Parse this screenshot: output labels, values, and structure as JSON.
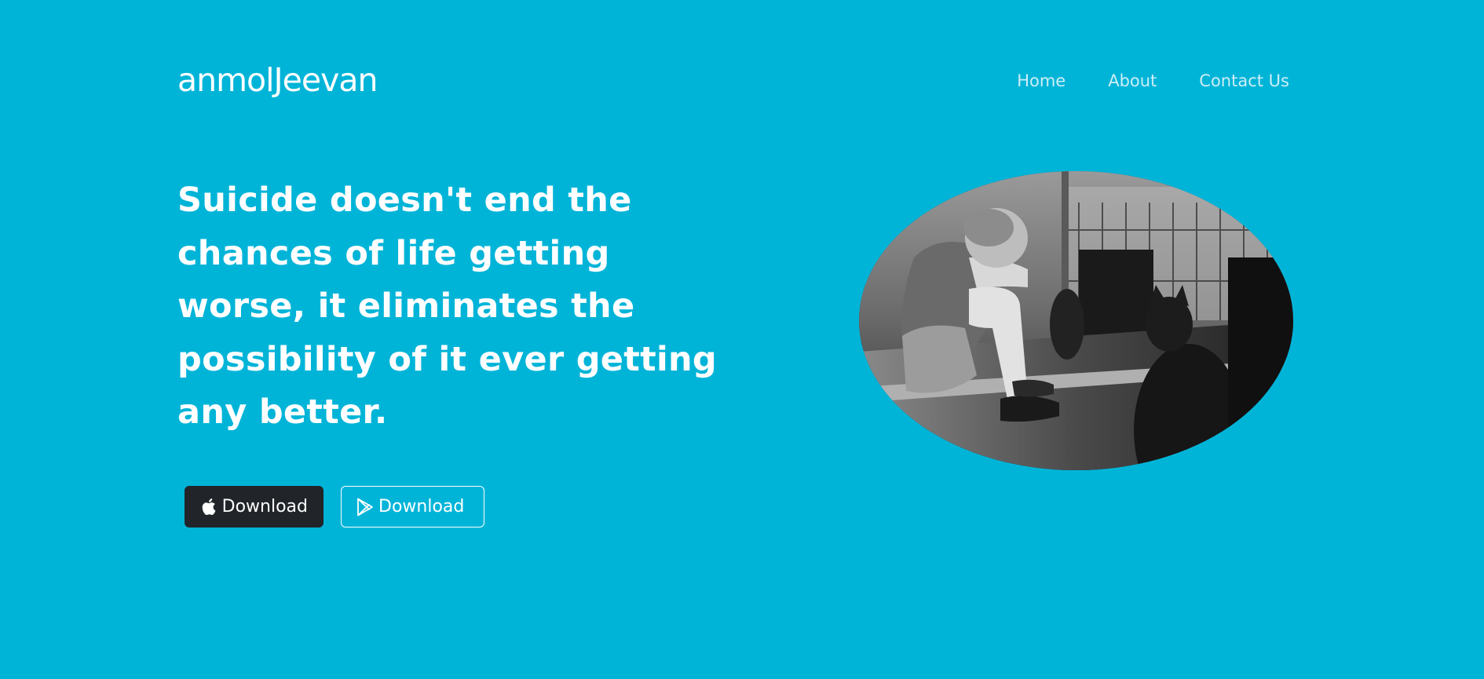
{
  "brand": {
    "name": "anmolJeevan"
  },
  "nav": {
    "items": [
      {
        "label": "Home"
      },
      {
        "label": "About"
      },
      {
        "label": "Contact Us"
      }
    ]
  },
  "hero": {
    "headline": "Suicide doesn't end the chances of life getting worse, it eliminates the possibility of it ever getting any better.",
    "buttons": {
      "apple": {
        "label": "Download",
        "icon": "apple-icon"
      },
      "play": {
        "label": "Download",
        "icon": "play-store-icon"
      }
    },
    "image": {
      "description_icon": "hero-photo"
    }
  },
  "colors": {
    "background": "#00b4d8",
    "text": "#ffffff",
    "nav_text": "#cdeef6",
    "dark_button": "#212529"
  }
}
